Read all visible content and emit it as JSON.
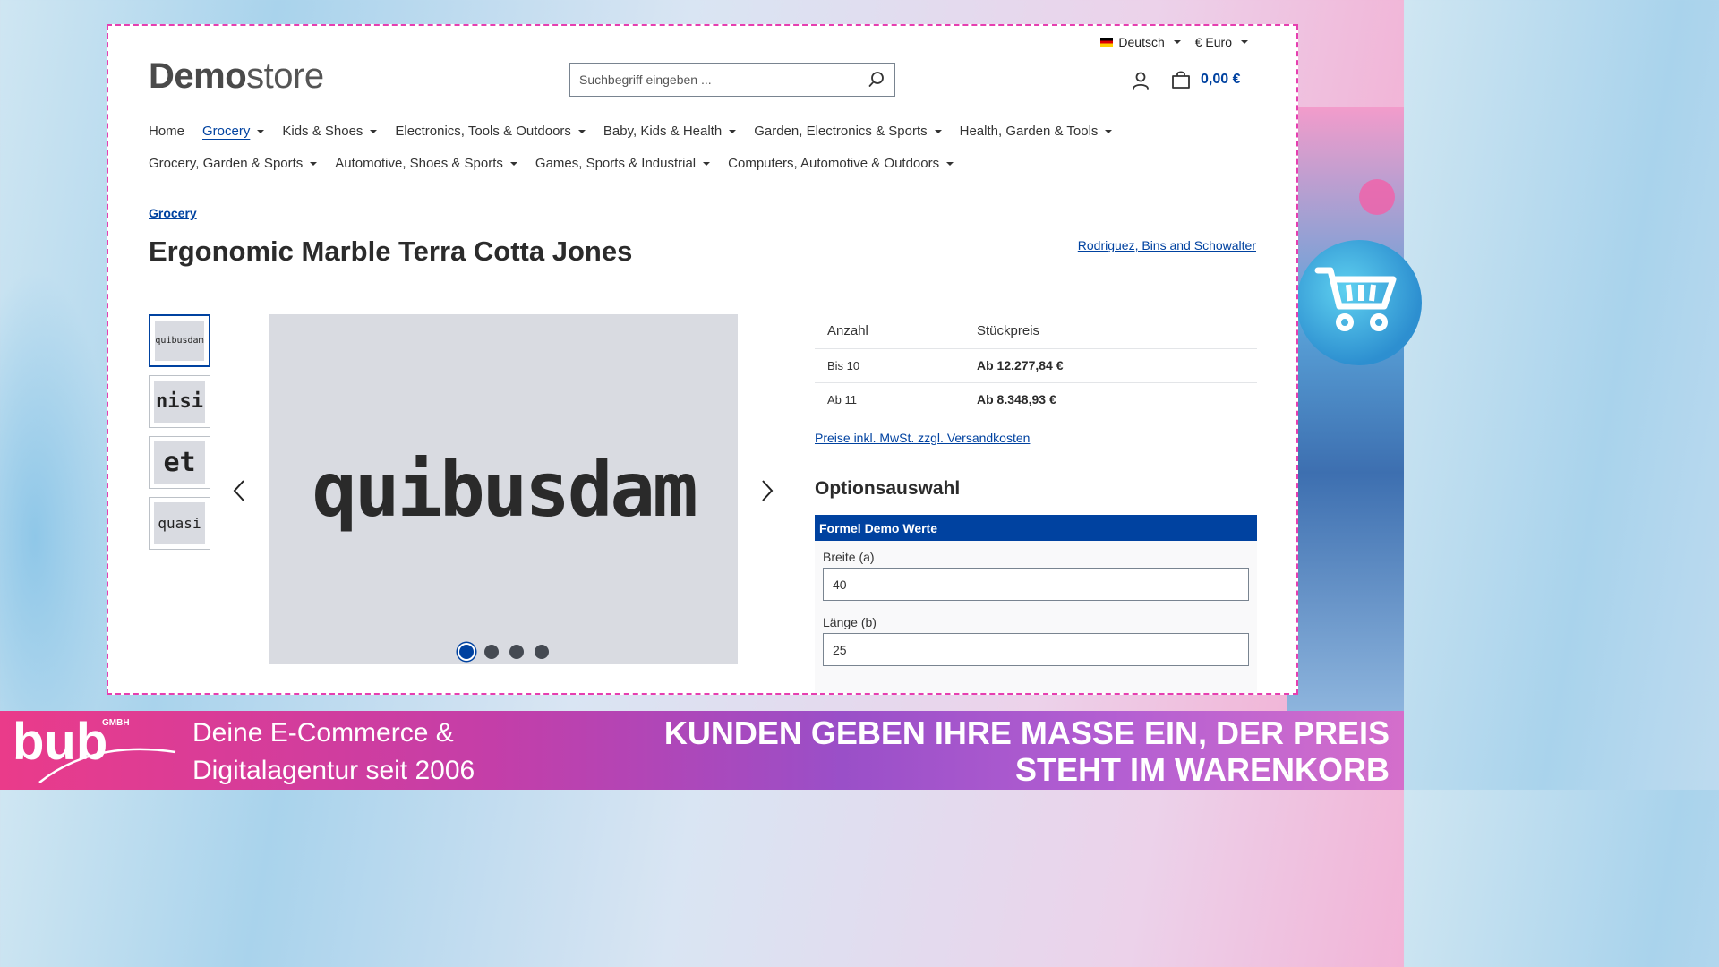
{
  "header": {
    "language": "Deutsch",
    "currency": "€ Euro",
    "logo_bold": "Demo",
    "logo_light": "store",
    "search_placeholder": "Suchbegriff eingeben ...",
    "cart_total": "0,00 €"
  },
  "nav": {
    "row1": [
      {
        "label": "Home",
        "dropdown": false
      },
      {
        "label": "Grocery",
        "dropdown": true,
        "active": true
      },
      {
        "label": "Kids & Shoes",
        "dropdown": true
      },
      {
        "label": "Electronics, Tools & Outdoors",
        "dropdown": true
      },
      {
        "label": "Baby, Kids & Health",
        "dropdown": true
      },
      {
        "label": "Garden, Electronics & Sports",
        "dropdown": true
      },
      {
        "label": "Health, Garden & Tools",
        "dropdown": true
      }
    ],
    "row2": [
      {
        "label": "Grocery, Garden & Sports",
        "dropdown": true
      },
      {
        "label": "Automotive, Shoes & Sports",
        "dropdown": true
      },
      {
        "label": "Games, Sports & Industrial",
        "dropdown": true
      },
      {
        "label": "Computers, Automotive & Outdoors",
        "dropdown": true
      }
    ]
  },
  "product": {
    "breadcrumb": "Grocery",
    "title": "Ergonomic Marble Terra Cotta Jones",
    "manufacturer": "Rodriguez, Bins and Schowalter",
    "thumbnails": [
      "quibusdam",
      "nisi",
      "et",
      "quasi"
    ],
    "main_image_text": "quibusdam",
    "active_slide": 1,
    "slide_count": 4
  },
  "pricing": {
    "col_quantity": "Anzahl",
    "col_unit_price": "Stückpreis",
    "rows": [
      {
        "quantity": "Bis 10",
        "price": "Ab 12.277,84 €"
      },
      {
        "quantity": "Ab 11",
        "price": "Ab 8.348,93 €"
      }
    ],
    "tax_link": "Preise inkl. MwSt. zzgl. Versandkosten"
  },
  "options": {
    "title": "Optionsauswahl",
    "group_title": "Formel Demo Werte",
    "fields": [
      {
        "label": "Breite (a)",
        "value": "40"
      },
      {
        "label": "Länge (b)",
        "value": "25"
      }
    ]
  },
  "banner": {
    "logo_text": "bub",
    "logo_suffix": "GMBH",
    "tagline_line1": "Deine E-Commerce &",
    "tagline_line2": "Digitalagentur seit 2006",
    "headline_line1": "KUNDEN GEBEN IHRE MASSE EIN, DER PREIS",
    "headline_line2": "STEHT IM WARENKORB"
  },
  "colors": {
    "accent": "#0042a0",
    "frame_border": "#e63fb0",
    "banner_start": "#ea3b8a",
    "banner_end": "#b45fd2"
  }
}
